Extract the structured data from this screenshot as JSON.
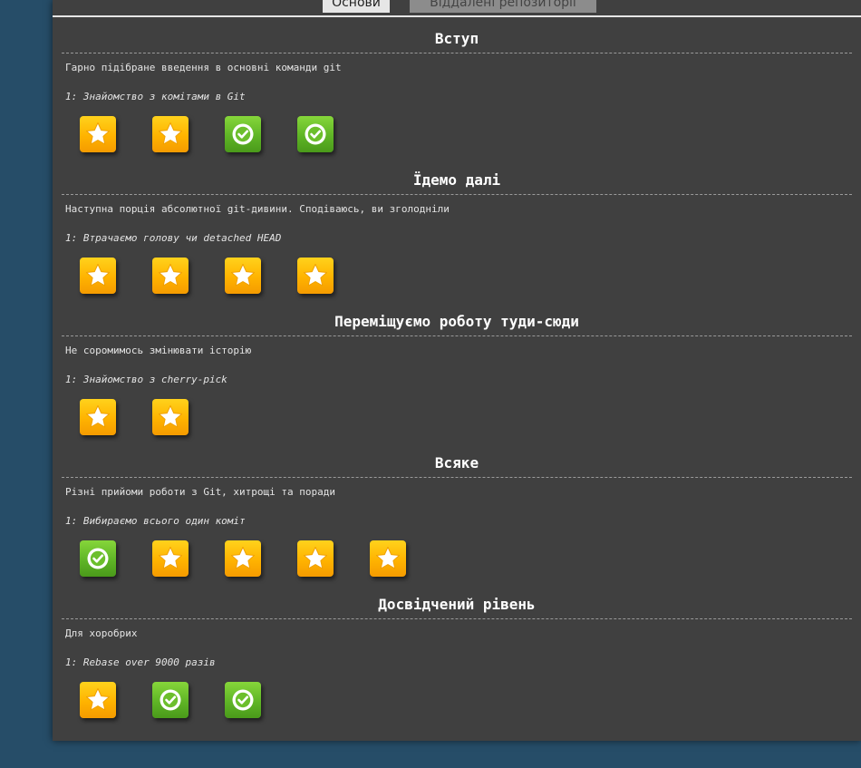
{
  "tabs": [
    {
      "label": "Основи",
      "active": true
    },
    {
      "label": "Віддалені репозиторії",
      "active": false
    }
  ],
  "sections": [
    {
      "title": "Вступ",
      "about": "Гарно підібране введення в основні команди git",
      "level_name": "1: Знайомство з комітами в Git",
      "levels": [
        "star-icon",
        "star-icon",
        "check-icon",
        "check-icon"
      ]
    },
    {
      "title": "Їдемо далі",
      "about": "Наступна порція абсолютної git-дивини. Сподіваюсь, ви зголодніли",
      "level_name": "1: Втрачаємо голову чи detached HEAD",
      "levels": [
        "star-icon",
        "star-icon",
        "star-icon",
        "star-icon"
      ]
    },
    {
      "title": "Переміщуємо роботу туди-сюди",
      "about": "Не соромимось змінювати історію",
      "level_name": "1: Знайомство з cherry-pick",
      "levels": [
        "star-icon",
        "star-icon"
      ]
    },
    {
      "title": "Всяке",
      "about": "Різні прийоми роботи з Git, хитрощі та поради",
      "level_name": "1: Вибираємо всього один коміт",
      "levels": [
        "check-icon",
        "star-icon",
        "star-icon",
        "star-icon",
        "star-icon"
      ]
    },
    {
      "title": "Досвідчений рівень",
      "about": "Для хоробрих",
      "level_name": "1: Rebase over 9000 разів",
      "levels": [
        "star-icon",
        "check-icon",
        "check-icon"
      ]
    }
  ],
  "colors": {
    "page_bg": "#264d68",
    "panel_bg": "#404040",
    "star_tile": "#ffb300",
    "done_tile": "#5fb526"
  }
}
